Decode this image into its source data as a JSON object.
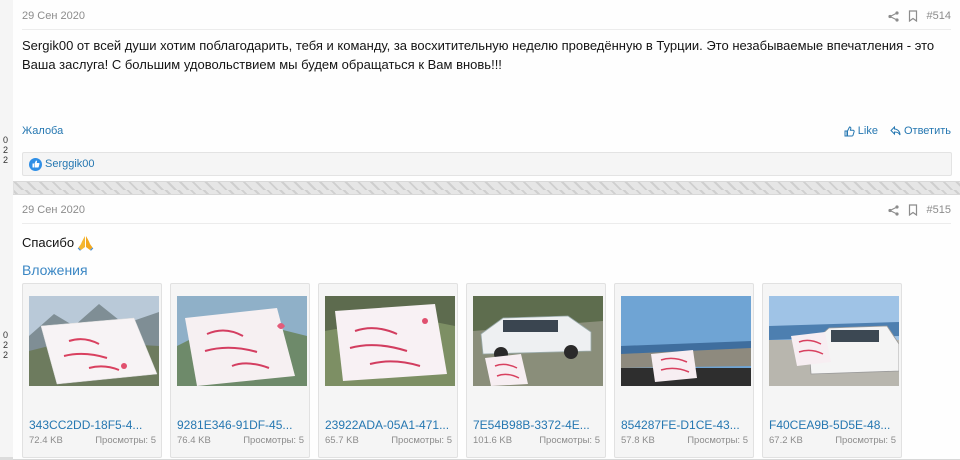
{
  "posts": [
    {
      "date": "29 Сен 2020",
      "number": "#514",
      "message_line1": "Sergik00 от всей души хотим поблагодарить, тебя и команду, за восхитительную неделю проведённую в Турции. Это незабываемые впечатления - это",
      "message_line2": "Ваша заслуга! С большим удовольствием мы будем обращаться к Вам вновь!!!",
      "report_label": "Жалоба",
      "like_label": "Like",
      "reply_label": "Ответить",
      "reaction_user": "Serggik00",
      "gutter_stats": [
        "0",
        "2",
        "2"
      ]
    },
    {
      "date": "29 Сен 2020",
      "number": "#515",
      "message": "Спасибо",
      "emoji": "pray-emoji",
      "attachments_title": "Вложения",
      "gutter_stats": [
        "0",
        "2",
        "2"
      ],
      "attachments": [
        {
          "name": "343CC2DD-18F5-4...",
          "size": "72.4 KB",
          "views": "Просмотры: 5"
        },
        {
          "name": "9281E346-91DF-45...",
          "size": "76.4 KB",
          "views": "Просмотры: 5"
        },
        {
          "name": "23922ADA-05A1-471...",
          "size": "65.7 KB",
          "views": "Просмотры: 5"
        },
        {
          "name": "7E54B98B-3372-4E...",
          "size": "101.6 KB",
          "views": "Просмотры: 5"
        },
        {
          "name": "854287FE-D1CE-43...",
          "size": "57.8 KB",
          "views": "Просмотры: 5"
        },
        {
          "name": "F40CEA9B-5D5E-48...",
          "size": "67.2 KB",
          "views": "Просмотры: 5"
        }
      ]
    }
  ],
  "colors": {
    "link": "#2577b1",
    "attach_title": "#3b87c4",
    "meta": "#8c8c8c"
  },
  "icons": [
    "share-icon",
    "bookmark-icon",
    "thumbs-up-icon",
    "reply-icon",
    "like-reaction-icon"
  ]
}
